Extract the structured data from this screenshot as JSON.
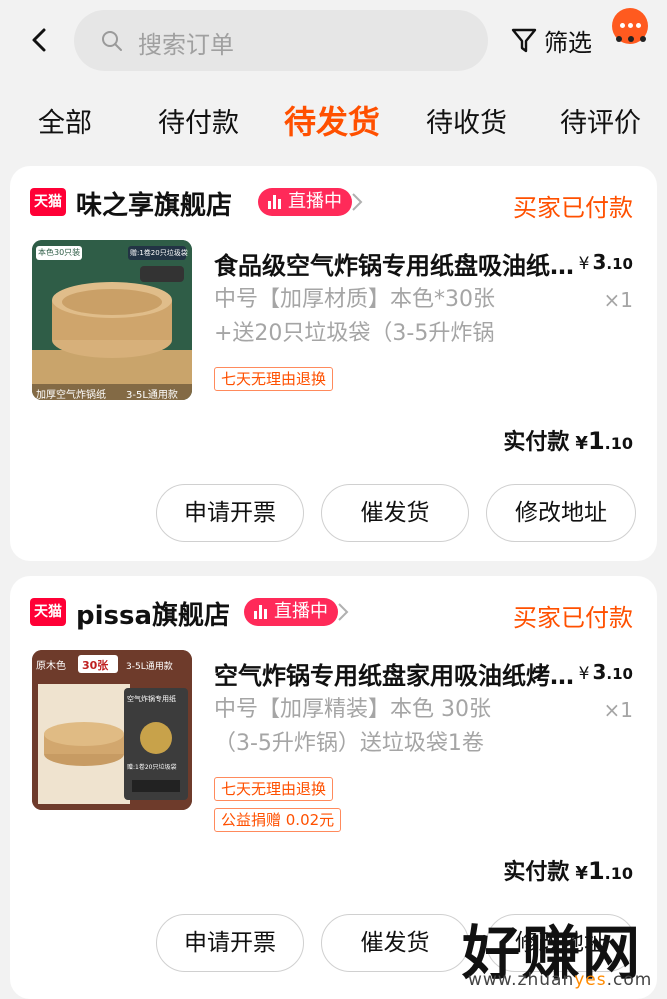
{
  "header": {
    "search_placeholder": "搜索订单",
    "filter_label": "筛选"
  },
  "tabs": [
    {
      "label": "全部"
    },
    {
      "label": "待付款"
    },
    {
      "label": "待发货",
      "active": true
    },
    {
      "label": "待收货"
    },
    {
      "label": "待评价"
    }
  ],
  "orders": [
    {
      "platform_badge": "天猫",
      "shop_name": "味之享旗舰店",
      "live_badge": "直播中",
      "status": "买家已付款",
      "product_title": "食品级空气炸锅专用纸盘吸油纸锡纸盘",
      "price_currency": "¥",
      "price_int": "3",
      "price_dec": ".10",
      "sku_line1": "中号【加厚材质】本色*30张",
      "sku_line2": "+送20只垃圾袋（3-5升炸锅",
      "quantity": "×1",
      "tags": [
        "七天无理由退换"
      ],
      "paid_label": "实付款",
      "paid_currency": "¥",
      "paid_int": "1",
      "paid_dec": ".10",
      "image_texts": [
        "本色30只装",
        "赠:1卷20只垃圾袋",
        "加厚空气炸锅纸",
        "3-5L通用款"
      ],
      "buttons": [
        "申请开票",
        "催发货",
        "修改地址"
      ]
    },
    {
      "platform_badge": "天猫",
      "shop_name": "pissa旗舰店",
      "live_badge": "直播中",
      "status": "买家已付款",
      "product_title": "空气炸锅专用纸盘家用吸油纸烤箱烘焙",
      "price_currency": "¥",
      "price_int": "3",
      "price_dec": ".10",
      "sku_line1": "中号【加厚精装】本色 30张",
      "sku_line2": "（3-5升炸锅）送垃圾袋1卷",
      "quantity": "×1",
      "tags": [
        "七天无理由退换",
        "公益捐赠 0.02元"
      ],
      "paid_label": "实付款",
      "paid_currency": "¥",
      "paid_int": "1",
      "paid_dec": ".10",
      "image_texts": [
        "原木色",
        "30张",
        "3-5L通用款",
        "空气炸锅专用纸",
        "赠:1卷20只垃圾袋"
      ],
      "buttons": [
        "申请开票",
        "催发货",
        "修改地址"
      ]
    }
  ],
  "watermark": {
    "text": "好赚网",
    "url_pre": "www.zhuan",
    "url_hl": "yes",
    "url_post": ".com"
  },
  "colors": {
    "accent": "#ff5000",
    "tmall_red": "#ff0036",
    "live_pink": "#ff2a59",
    "background": "#f2f2f2"
  }
}
